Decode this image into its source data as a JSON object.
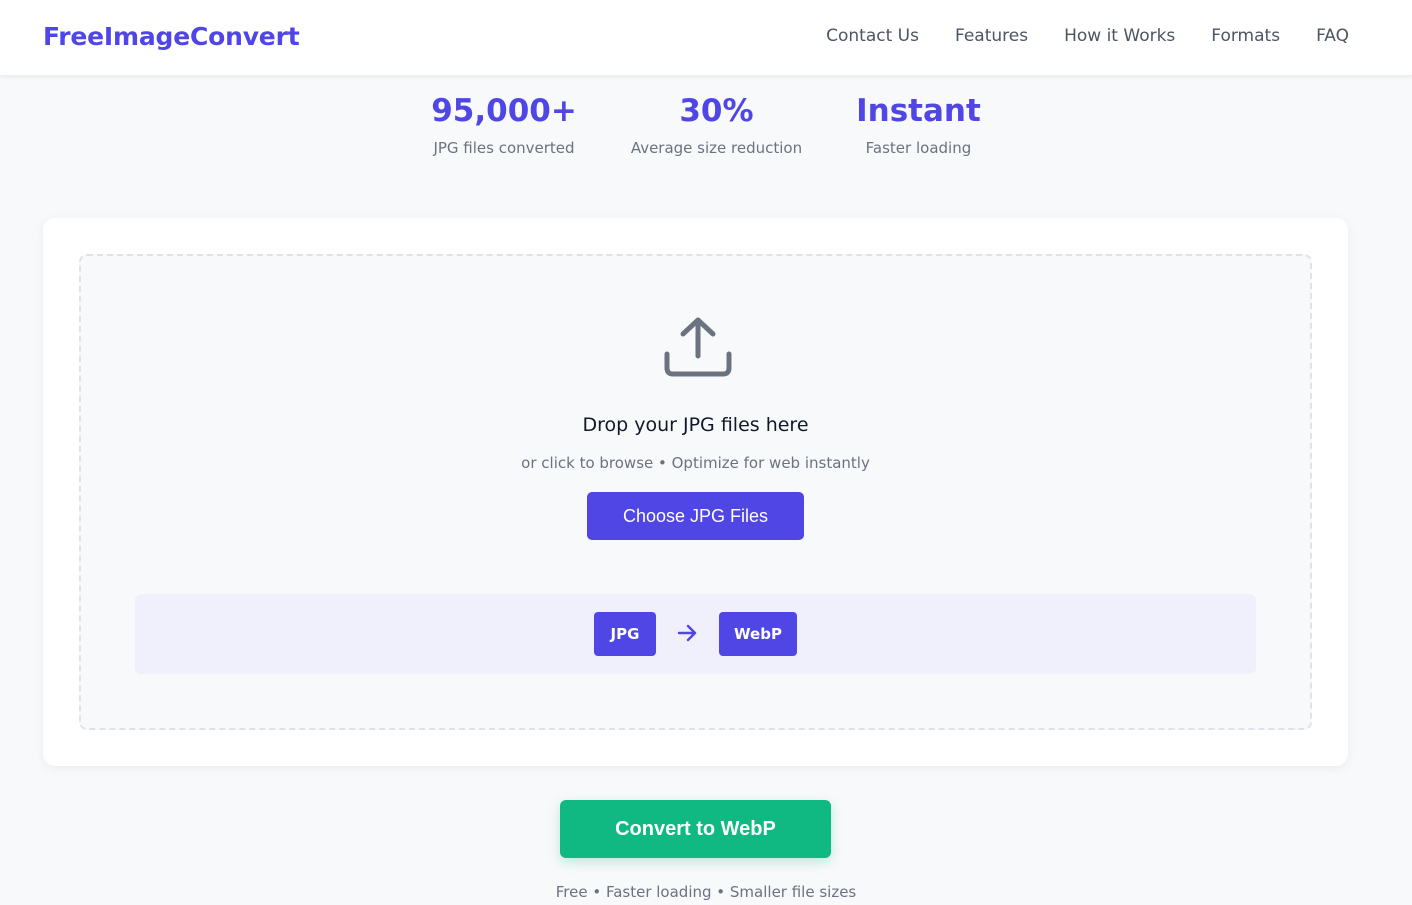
{
  "header": {
    "brand": "FreeImageConvert",
    "nav": [
      "Contact Us",
      "Features",
      "How it Works",
      "Formats",
      "FAQ"
    ]
  },
  "stats": [
    {
      "value": "95,000+",
      "label": "JPG files converted"
    },
    {
      "value": "30%",
      "label": "Average size reduction"
    },
    {
      "value": "Instant",
      "label": "Faster loading"
    }
  ],
  "upload": {
    "icon": "upload-icon",
    "title": "Drop your JPG files here",
    "subtitle": "or click to browse • Optimize for web instantly",
    "choose_label": "Choose JPG Files",
    "from_format": "JPG",
    "to_format": "WebP",
    "arrow_icon": "arrow-right-icon"
  },
  "convert": {
    "label": "Convert to WebP",
    "note": "Free • Faster loading • Smaller file sizes"
  },
  "colors": {
    "brand": "#4f46e5",
    "accent_green": "#10b981",
    "muted_text": "#6b7280",
    "strip_bg": "#f0f0fc"
  }
}
